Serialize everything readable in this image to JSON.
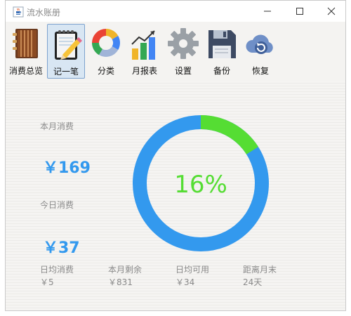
{
  "window": {
    "title": "流水账册",
    "controls": [
      "minimize-icon",
      "maximize-icon",
      "close-icon"
    ]
  },
  "toolbar": {
    "items": [
      {
        "label": "消费总览",
        "icon": "ledger-book-icon",
        "active": false
      },
      {
        "label": "记一笔",
        "icon": "notepad-pencil-icon",
        "active": true
      },
      {
        "label": "分类",
        "icon": "pie-ring-icon",
        "active": false
      },
      {
        "label": "月报表",
        "icon": "bar-chart-trend-icon",
        "active": false
      },
      {
        "label": "设置",
        "icon": "gear-icon",
        "active": false
      },
      {
        "label": "备份",
        "icon": "floppy-disk-icon",
        "active": false
      },
      {
        "label": "恢复",
        "icon": "cloud-restore-icon",
        "active": false
      }
    ]
  },
  "summary": {
    "month_label": "本月消费",
    "month_value": "￥169",
    "today_label": "今日消费",
    "today_value": "￥37",
    "progress_percent": 16,
    "progress_text": "16%",
    "colors": {
      "accent_blue": "#3399ee",
      "accent_green": "#55dd33",
      "label_gray": "#8a8a8a"
    },
    "stats": [
      {
        "label": "日均消费",
        "value": "￥5"
      },
      {
        "label": "本月剩余",
        "value": "￥831"
      },
      {
        "label": "日均可用",
        "value": "￥34"
      },
      {
        "label": "距离月末",
        "value": "24天"
      }
    ]
  }
}
